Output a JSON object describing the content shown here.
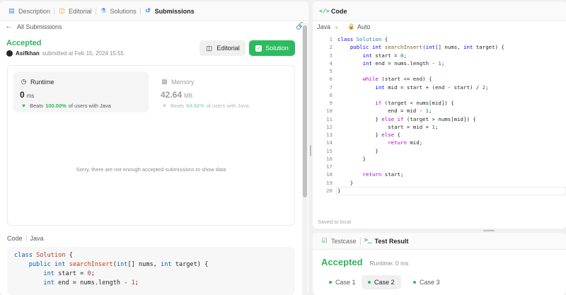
{
  "left": {
    "tabs": [
      {
        "label": "Description",
        "icon": "description-icon"
      },
      {
        "label": "Editorial",
        "icon": "editorial-icon"
      },
      {
        "label": "Solutions",
        "icon": "flask-icon"
      },
      {
        "label": "Submissions",
        "icon": "history-icon"
      }
    ],
    "back_label": "All Submissions",
    "status": "Accepted",
    "user": "Asifkhan",
    "submitted_text": "submitted at Feb 15, 2024 15:55",
    "editorial_button": "Editorial",
    "solution_button": "Solution",
    "runtime": {
      "label": "Runtime",
      "value": "0",
      "unit": "ms",
      "beats_prefix": "Beats",
      "beats_pct": "100.00%",
      "beats_suffix": "of users with Java"
    },
    "memory": {
      "label": "Memory",
      "value": "42.64",
      "unit": "MB",
      "beats_prefix": "Beats",
      "beats_pct": "84.92%",
      "beats_suffix": "of users with Java"
    },
    "no_data_text": "Sorry, there are not enough accepted submissions to show data",
    "code_label": "Code",
    "code_lang": "Java",
    "code_preview": [
      "class Solution {",
      "    public int searchInsert(int[] nums, int target) {",
      "        int start = 0;",
      "        int end = nums.length - 1;",
      ""
    ]
  },
  "editor": {
    "title": "Code",
    "language": "Java",
    "auto_label": "Auto",
    "saved_text": "Saved to local",
    "line_numbers": [
      "1",
      "2",
      "3",
      "4",
      "5",
      "6",
      "7",
      "8",
      "9",
      "10",
      "11",
      "12",
      "13",
      "14",
      "15",
      "16",
      "17",
      "18",
      "19",
      "20"
    ],
    "lines": [
      "class Solution {",
      "    public int searchInsert(int[] nums, int target) {",
      "        int start = 0;",
      "        int end = nums.length - 1;",
      "",
      "        while (start <= end) {",
      "            int mid = start + (end - start) / 2;",
      "",
      "            if (target < nums[mid]) {",
      "                end = mid - 1;",
      "            } else if (target > nums[mid]) {",
      "                start = mid + 1;",
      "            } else {",
      "                return mid;",
      "            }",
      "        }",
      "",
      "        return start;",
      "    }",
      "}"
    ]
  },
  "result": {
    "testcase_tab": "Testcase",
    "result_tab": "Test Result",
    "status": "Accepted",
    "runtime_text": "Runtime: 0 ms",
    "cases": [
      "Case 1",
      "Case 2",
      "Case 3"
    ],
    "active_case": 1
  },
  "colors": {
    "accent_green": "#2cbb5d",
    "accepted_green": "#2db55d",
    "button_green": "#2cbb5d"
  }
}
